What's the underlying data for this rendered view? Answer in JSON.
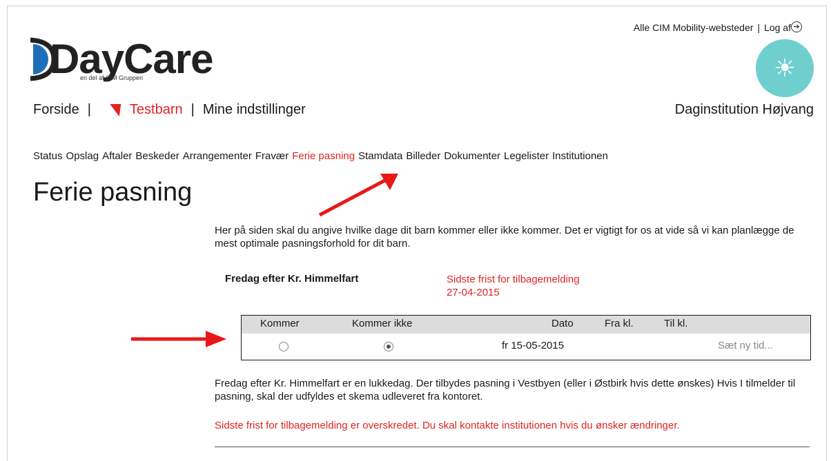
{
  "header": {
    "all_sites_link": "Alle CIM Mobility-websteder",
    "separator": "|",
    "logout_link": "Log af",
    "logo_text": "DayCare",
    "logo_tagline": "en del af CIM Gruppen"
  },
  "main_nav": {
    "home": "Forside",
    "child": "Testbarn",
    "settings": "Mine indstillinger",
    "institution": "Daginstitution Højvang"
  },
  "sub_nav": {
    "items": [
      "Status",
      "Opslag",
      "Aftaler",
      "Beskeder",
      "Arrangementer",
      "Fravær",
      "Ferie pasning",
      "Stamdata",
      "Billeder",
      "Dokumenter",
      "Legelister",
      "Institutionen"
    ],
    "active": "Ferie pasning"
  },
  "page": {
    "title": "Ferie pasning",
    "intro": "Her på siden skal du angive hvilke dage dit barn kommer eller ikke kommer. Det er vigtigt for os at vide så vi kan planlægge de mest optimale pasningsforhold for dit barn.",
    "day_name": "Fredag efter Kr. Himmelfart",
    "deadline_label": "Sidste frist for tilbagemelding",
    "deadline_date": "27-04-2015"
  },
  "table": {
    "headers": [
      "Kommer",
      "Kommer ikke",
      "Dato",
      "Fra kl.",
      "Til kl."
    ],
    "row": {
      "kommer_selected": false,
      "kommer_ikke_selected": true,
      "date": "fr 15-05-2015",
      "new_time": "Sæt ny tid..."
    }
  },
  "note": "Fredag efter Kr. Himmelfart er en lukkedag. Der tilbydes pasning i Vestbyen (eller i Østbirk hvis dette ønskes) Hvis I tilmelder til pasning, skal der udfyldes et skema udleveret fra kontoret.",
  "warning": "Sidste frist for tilbagemelding er overskredet. Du skal kontakte institutionen hvis du ønsker ændringer.",
  "colors": {
    "accent_red": "#e02424",
    "sun_teal": "#6ecfce",
    "header_gray": "#dcdcdc"
  }
}
